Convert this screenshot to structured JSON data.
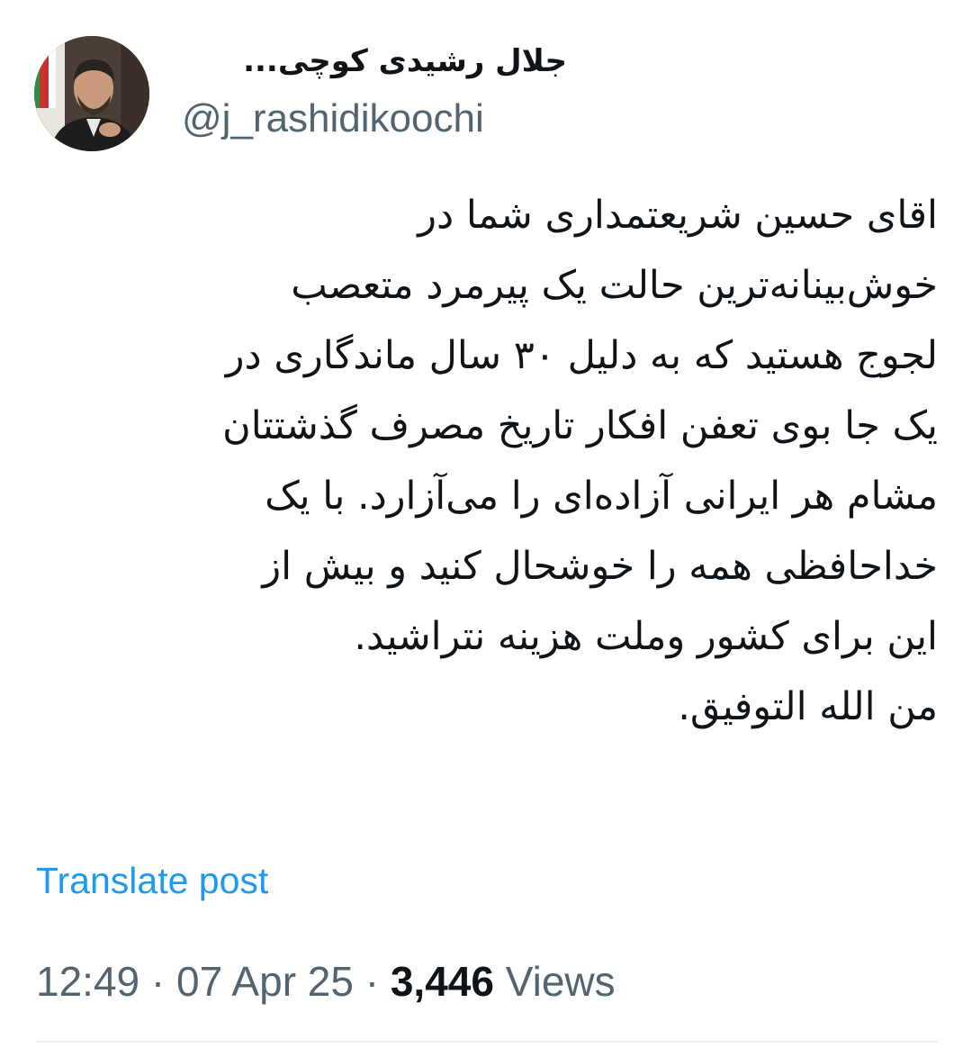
{
  "author": {
    "display_name": "جلال رشیدی کوچی...",
    "handle": "@j_rashidikoochi",
    "avatar_icon": "profile-photo"
  },
  "tweet": {
    "lines": [
      "اقای حسین شریعتمداری شما در",
      "خوش‌بینانه‌ترین حالت یک پیرمرد متعصب",
      "لجوج هستید که به دلیل ۳۰ سال ماندگاری در",
      "یک جا بوی تعفن افکار تاریخ مصرف گذشتتان",
      "مشام هر ایرانی آزاده‌ای را می‌آزارد. با یک",
      "خداحافظی همه را خوشحال کنید و بیش از",
      "این برای کشور وملت هزینه نتراشید.",
      "من الله التوفیق."
    ]
  },
  "actions": {
    "translate_label": "Translate post"
  },
  "meta": {
    "time": "12:49",
    "separator": "·",
    "date": "07 Apr 25",
    "views_count": "3,446",
    "views_label": "Views"
  },
  "colors": {
    "link": "#1d9bf0",
    "text": "#0f1419",
    "secondary": "#536471"
  }
}
